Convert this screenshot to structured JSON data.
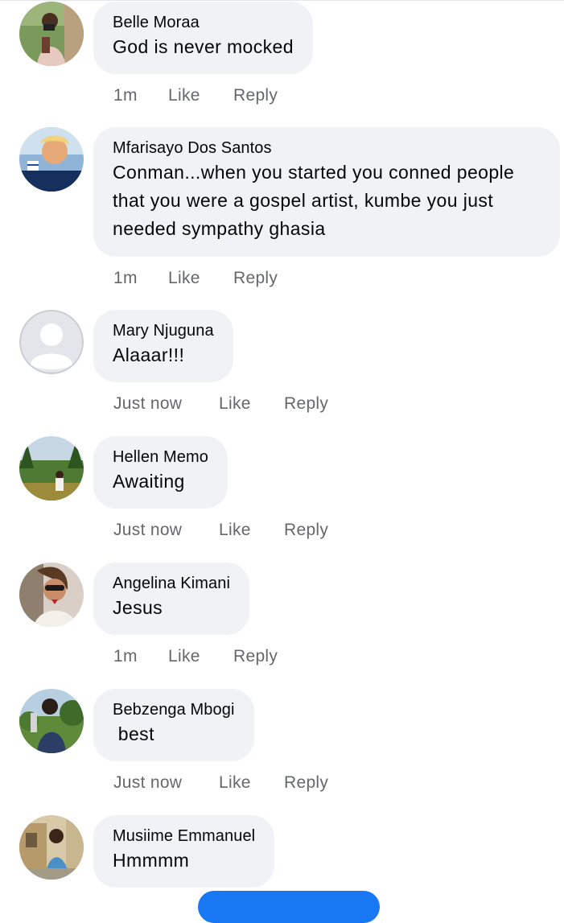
{
  "colors": {
    "bubble": "#f0f2f5",
    "meta_text": "#65676b",
    "accent": "#1877f2"
  },
  "comments": [
    {
      "avatar": "avatar-photo-woman-camera",
      "author": "Belle Moraa",
      "lines": [
        "God is never mocked"
      ],
      "time": "1m",
      "like": "Like",
      "reply": "Reply"
    },
    {
      "avatar": "avatar-photo-man-forever-banner",
      "avatar_banner": "FOREVER",
      "author": "Mfarisayo Dos Santos",
      "lines": [
        "Conman...when you started you conned people",
        "that you were a gospel artist, kumbe you just",
        "needed sympathy ghasia"
      ],
      "time": "1m",
      "like": "Like",
      "reply": "Reply"
    },
    {
      "avatar": "default-profile-icon",
      "author": "Mary Njuguna",
      "lines": [
        "Alaaar!!!"
      ],
      "time": "Just now",
      "like": "Like",
      "reply": "Reply"
    },
    {
      "avatar": "avatar-photo-outdoor-garden",
      "author": "Hellen Memo",
      "lines": [
        "Awaiting"
      ],
      "time": "Just now",
      "like": "Like",
      "reply": "Reply"
    },
    {
      "avatar": "avatar-photo-woman-sunglasses",
      "author": "Angelina Kimani",
      "lines": [
        "Jesus"
      ],
      "time": "1m",
      "like": "Like",
      "reply": "Reply"
    },
    {
      "avatar": "avatar-photo-man-trees",
      "author": "Bebzenga Mbogi",
      "lines": [
        " best"
      ],
      "time": "Just now",
      "like": "Like",
      "reply": "Reply"
    },
    {
      "avatar": "avatar-photo-man-building",
      "author": "Musiime Emmanuel",
      "lines": [
        "Hmmmm"
      ]
    }
  ]
}
